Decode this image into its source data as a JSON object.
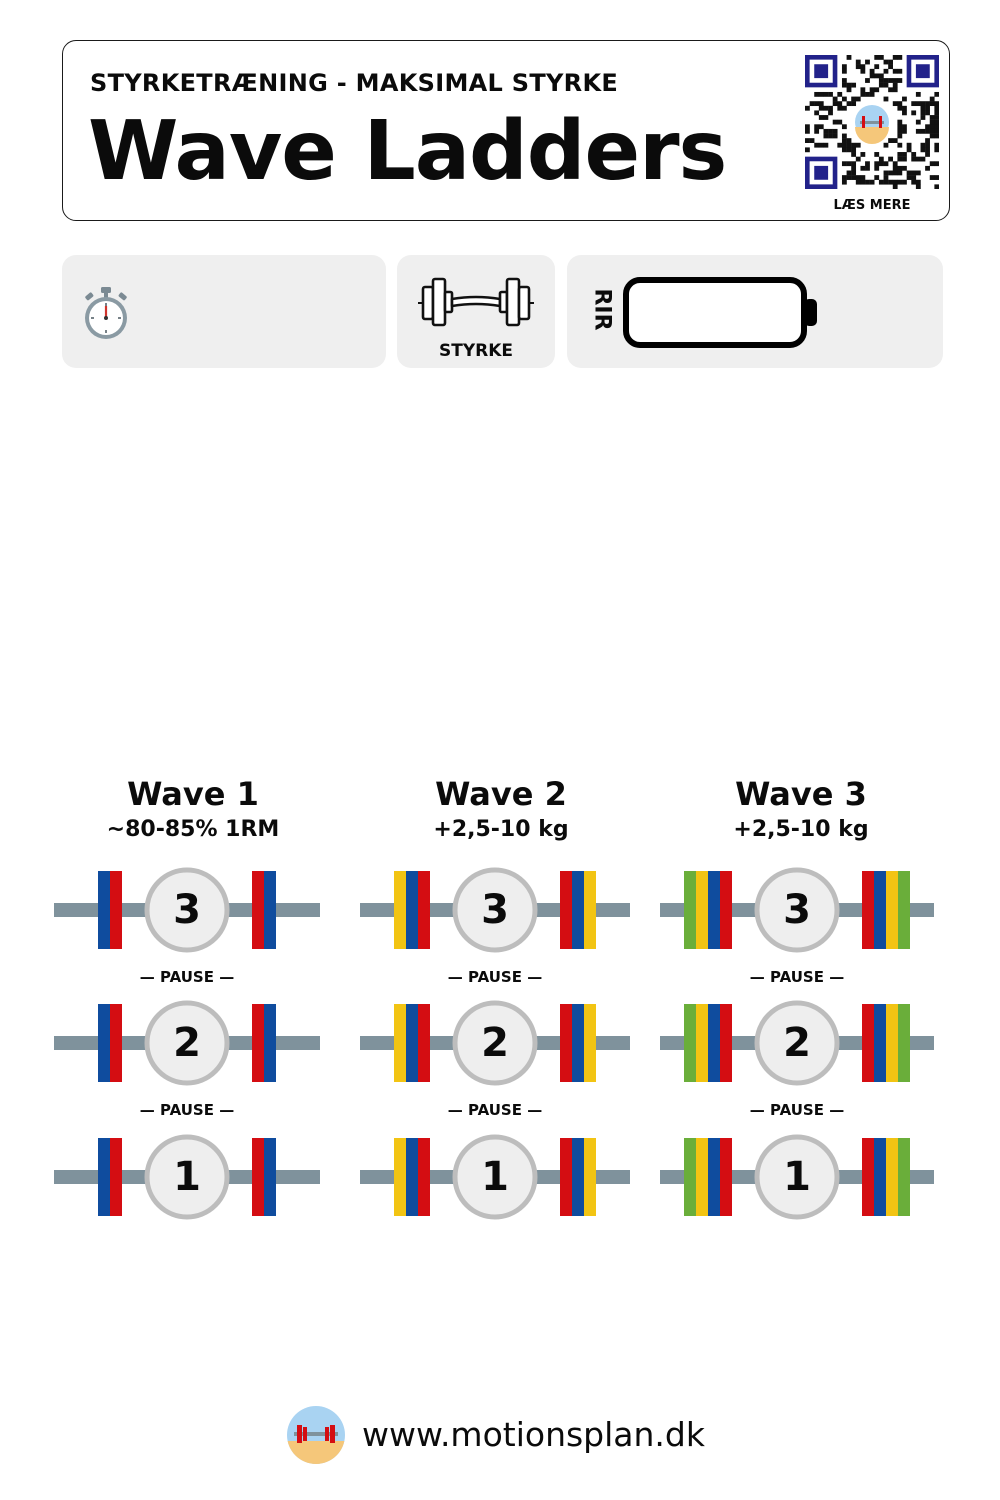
{
  "header": {
    "subtitle": "STYRKETRÆNING - MAKSIMAL STYRKE",
    "title": "Wave Ladders",
    "qr_label": "LÆS MERE"
  },
  "info": {
    "time_icon": "stopwatch-icon",
    "type_icon": "barbell-icon",
    "type_label": "STYRKE",
    "rir_label": "RIR",
    "rir_icon": "battery-icon"
  },
  "waves": [
    {
      "title": "Wave 1",
      "subtitle": "~80-85% 1RM",
      "plates": [
        "#0f4c9e",
        "#d40d12"
      ],
      "reps": [
        "3",
        "2",
        "1"
      ]
    },
    {
      "title": "Wave 2",
      "subtitle": "+2,5-10 kg",
      "plates": [
        "#f2c413",
        "#0f4c9e",
        "#d40d12"
      ],
      "reps": [
        "3",
        "2",
        "1"
      ]
    },
    {
      "title": "Wave 3",
      "subtitle": "+2,5-10 kg",
      "plates": [
        "#6aae3a",
        "#f2c413",
        "#0f4c9e",
        "#d40d12"
      ],
      "reps": [
        "3",
        "2",
        "1"
      ]
    }
  ],
  "pause_label": "— PAUSE —",
  "colors": {
    "bar": "#7f929c",
    "circle_fill": "#eeeeee",
    "circle_stroke": "#bdbdbd",
    "panel_bg": "#efefef"
  },
  "footer": {
    "url": "www.motionsplan.dk",
    "logo_icon": "motionsplan-logo-icon"
  }
}
